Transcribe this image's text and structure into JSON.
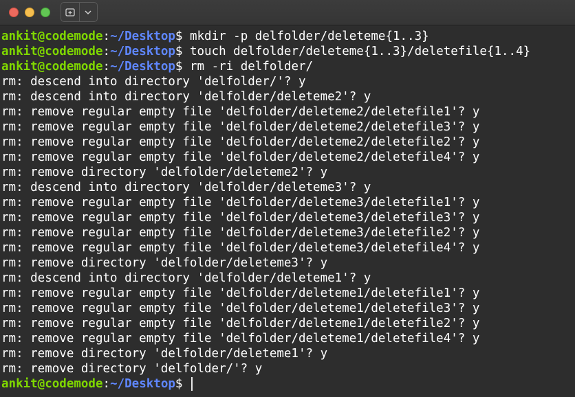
{
  "window": {
    "traffic_lights": [
      "close",
      "minimize",
      "maximize"
    ],
    "tab_buttons": [
      {
        "icon": "new-tab-icon"
      },
      {
        "icon": "chevron-down-icon"
      }
    ]
  },
  "prompt": {
    "user_host": "ankit@codemode",
    "colon": ":",
    "path": "~/Desktop",
    "symbol": "$ "
  },
  "colors": {
    "user": "#7fd700",
    "path": "#5f87ff",
    "text": "#ffffff",
    "background": "#2d2d2d"
  },
  "commands": [
    "mkdir -p delfolder/deleteme{1..3}",
    "touch delfolder/deleteme{1..3}/deletefile{1..4}",
    "rm -ri delfolder/"
  ],
  "output": [
    "rm: descend into directory 'delfolder/'? y",
    "rm: descend into directory 'delfolder/deleteme2'? y",
    "rm: remove regular empty file 'delfolder/deleteme2/deletefile1'? y",
    "rm: remove regular empty file 'delfolder/deleteme2/deletefile3'? y",
    "rm: remove regular empty file 'delfolder/deleteme2/deletefile2'? y",
    "rm: remove regular empty file 'delfolder/deleteme2/deletefile4'? y",
    "rm: remove directory 'delfolder/deleteme2'? y",
    "rm: descend into directory 'delfolder/deleteme3'? y",
    "rm: remove regular empty file 'delfolder/deleteme3/deletefile1'? y",
    "rm: remove regular empty file 'delfolder/deleteme3/deletefile3'? y",
    "rm: remove regular empty file 'delfolder/deleteme3/deletefile2'? y",
    "rm: remove regular empty file 'delfolder/deleteme3/deletefile4'? y",
    "rm: remove directory 'delfolder/deleteme3'? y",
    "rm: descend into directory 'delfolder/deleteme1'? y",
    "rm: remove regular empty file 'delfolder/deleteme1/deletefile1'? y",
    "rm: remove regular empty file 'delfolder/deleteme1/deletefile3'? y",
    "rm: remove regular empty file 'delfolder/deleteme1/deletefile2'? y",
    "rm: remove regular empty file 'delfolder/deleteme1/deletefile4'? y",
    "rm: remove directory 'delfolder/deleteme1'? y",
    "rm: remove directory 'delfolder/'? y"
  ]
}
